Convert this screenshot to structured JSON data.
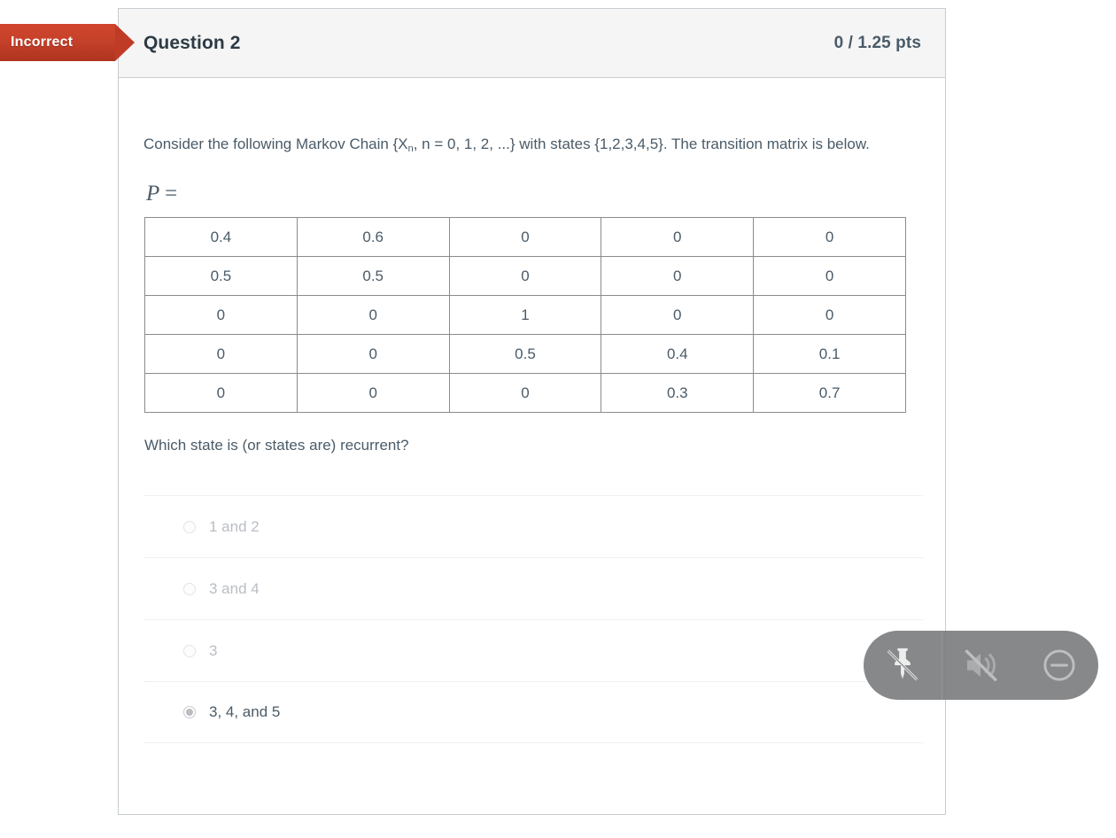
{
  "flag": {
    "label": "Incorrect",
    "color": "#c6412a"
  },
  "header": {
    "title": "Question 2",
    "points": "0 / 1.25 pts"
  },
  "body": {
    "prompt_part1": "Consider the following Markov Chain {X",
    "prompt_sub": "n",
    "prompt_part2": ", n = 0, 1, 2, ...} with states {1,2,3,4,5}.  The transition matrix is below.",
    "matrix_label_p": "P",
    "matrix_label_eq": "=",
    "recurrent_question": "Which state is (or states are) recurrent?"
  },
  "matrix": {
    "rows": [
      [
        "0.4",
        "0.6",
        "0",
        "0",
        "0"
      ],
      [
        "0.5",
        "0.5",
        "0",
        "0",
        "0"
      ],
      [
        "0",
        "0",
        "1",
        "0",
        "0"
      ],
      [
        "0",
        "0",
        "0.5",
        "0.4",
        "0.1"
      ],
      [
        "0",
        "0",
        "0",
        "0.3",
        "0.7"
      ]
    ]
  },
  "answers": [
    {
      "label": "1 and 2",
      "selected": false
    },
    {
      "label": "3 and 4",
      "selected": false
    },
    {
      "label": "3",
      "selected": false
    },
    {
      "label": "3, 4, and 5",
      "selected": true
    }
  ],
  "overlay_toolbar": {
    "buttons": [
      {
        "name": "unpin-icon",
        "title": "Unpin"
      },
      {
        "name": "mute-icon",
        "title": "Muted"
      },
      {
        "name": "minimize-icon",
        "title": "Minimize"
      }
    ]
  }
}
